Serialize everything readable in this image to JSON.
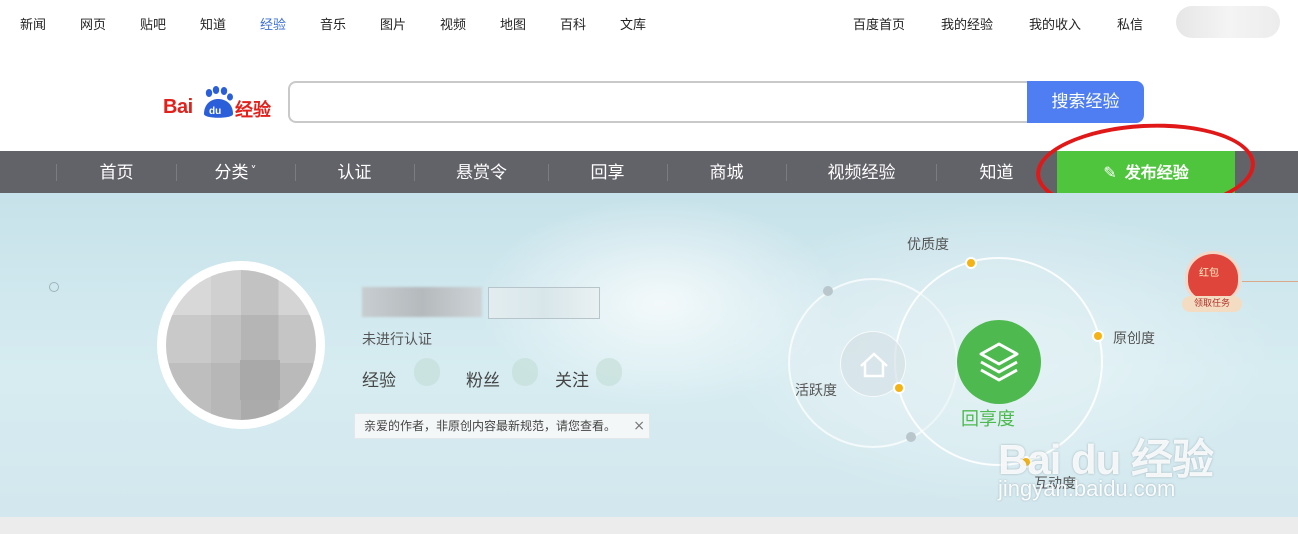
{
  "top_nav": {
    "left": [
      "新闻",
      "网页",
      "贴吧",
      "知道",
      "经验",
      "音乐",
      "图片",
      "视频",
      "地图",
      "百科",
      "文库"
    ],
    "active": "经验",
    "right": [
      "百度首页",
      "我的经验",
      "我的收入",
      "私信"
    ]
  },
  "logo": {
    "bai": "Bai",
    "du": "du",
    "suffix": "经验"
  },
  "search": {
    "value": "",
    "placeholder": "",
    "button": "搜索经验"
  },
  "main_nav": {
    "items": [
      "首页",
      "分类",
      "认证",
      "悬赏令",
      "回享",
      "商城",
      "视频经验",
      "知道"
    ],
    "dropdown_marker": "˅",
    "publish": "发布经验"
  },
  "profile": {
    "certification": "未进行认证",
    "stats": [
      "经验",
      "粉丝",
      "关注"
    ],
    "notice": "亲爱的作者，非原创内容最新规范，请您查看。",
    "notice_close": "×"
  },
  "radar": {
    "labels": {
      "top": "优质度",
      "right": "原创度",
      "left": "活跃度",
      "bottom": "互动度"
    },
    "core": "回享度"
  },
  "red_packet": {
    "title": "红包",
    "action": "领取任务"
  },
  "watermark": {
    "brand": "Bai du 经验",
    "url": "jingyan.baidu.com"
  },
  "colors": {
    "accent": "#4e7ef1",
    "nav_bg": "#626269",
    "publish": "#4fc43d",
    "highlight": "#e01818",
    "core": "#4db94e"
  }
}
